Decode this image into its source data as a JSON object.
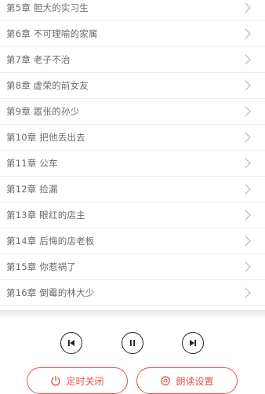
{
  "chapters": [
    {
      "label": "第5章 胆大的实习生"
    },
    {
      "label": "第6章 不可理喻的家属"
    },
    {
      "label": "第7章 老子不治"
    },
    {
      "label": "第8章 虚荣的前女友"
    },
    {
      "label": "第9章 嚣张的孙少"
    },
    {
      "label": "第10章 把他丢出去"
    },
    {
      "label": "第11章 公车"
    },
    {
      "label": "第12章 捡漏"
    },
    {
      "label": "第13章 眼红的店主"
    },
    {
      "label": "第14章 后悔的店老板"
    },
    {
      "label": "第15章 你惹祸了"
    },
    {
      "label": "第16章 倒霉的林大少"
    }
  ],
  "player": {
    "prev_icon": "skip-previous-icon",
    "pause_icon": "pause-icon",
    "next_icon": "skip-next-icon"
  },
  "buttons": {
    "timer_label": "定时关闭",
    "timer_icon": "power-icon",
    "settings_label": "朗读设置",
    "settings_icon": "gear-icon"
  },
  "colors": {
    "accent": "#e5544b",
    "text": "#6a6a6a",
    "divider": "#ececec",
    "control": "#1f1f1f"
  }
}
